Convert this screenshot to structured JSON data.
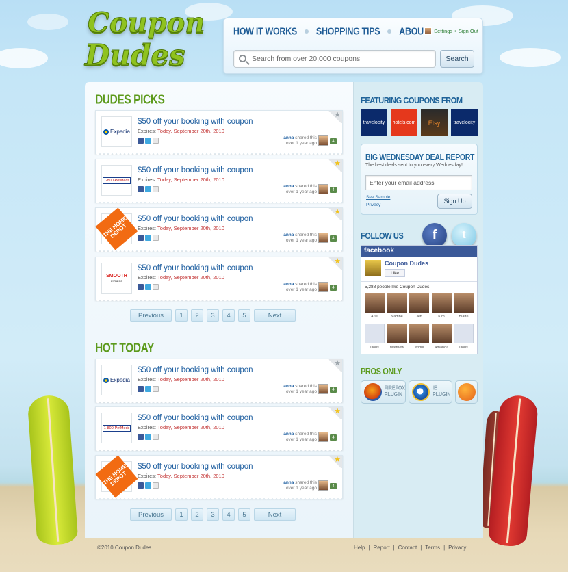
{
  "brand": {
    "line1": "Coupon",
    "line2": "Dudes"
  },
  "nav": {
    "items": [
      "HOW IT WORKS",
      "SHOPPING TIPS",
      "ABOUT"
    ],
    "settings": "Settings",
    "separator": "•",
    "signout": "Sign Out"
  },
  "search": {
    "placeholder": "Search from over 20,000 coupons",
    "button": "Search"
  },
  "sections": {
    "picks": "DUDES PICKS",
    "hot": "HOT TODAY"
  },
  "card": {
    "title": "$50 off your booking with coupon",
    "expires_label": "Expires:",
    "expires_date": "Today, September 20th, 2010",
    "user": "anna",
    "shared": "shared this",
    "ago": "over 1 year ago",
    "count": "4"
  },
  "merchants": {
    "expedia": "Expedia",
    "petmeds": "1-800-PetMeds",
    "homedepot": "THE HOME DEPOT",
    "smooth": "SMOOTH",
    "smooth_sub": "FITNESS"
  },
  "pager": {
    "previous": "Previous",
    "next": "Next",
    "pages": [
      "1",
      "2",
      "3",
      "4",
      "5"
    ]
  },
  "featuring": {
    "title": "FEATURING COUPONS FROM",
    "logos": [
      "travelocity",
      "hotels.com",
      "Etsy",
      "travelocity"
    ]
  },
  "deal": {
    "title": "BIG WEDNESDAY DEAL REPORT",
    "subtitle": "The best deals sent to you every Wednesday!",
    "placeholder": "Enter your email address",
    "sample": "See Sample",
    "privacy": "Privacy",
    "button": "Sign Up"
  },
  "follow": {
    "title": "FOLLOW US",
    "fb_header": "facebook",
    "page_name": "Coupon Dudes",
    "like": "Like",
    "count_text": "5,288 people like Coupon Dudes",
    "people": [
      "Ariel",
      "Nadine",
      "Jeff",
      "Kim",
      "Blaire",
      "Doris",
      "Matthew",
      "Widhi",
      "Amanda",
      "Doris"
    ]
  },
  "pros": {
    "title": "PROS ONLY",
    "firefox": [
      "FIREFOX",
      "PLUGIN"
    ],
    "ie": [
      "IE",
      "PLUGIN"
    ]
  },
  "footer": {
    "copyright": "©2010 Coupon Dudes",
    "links": [
      "Help",
      "Report",
      "Contact",
      "Terms",
      "Privacy"
    ],
    "sep": "|"
  },
  "colors": {
    "nav": "#1f5c96",
    "green": "#5c9a1c",
    "red": "#c23232",
    "facebook": "#3b5998"
  }
}
